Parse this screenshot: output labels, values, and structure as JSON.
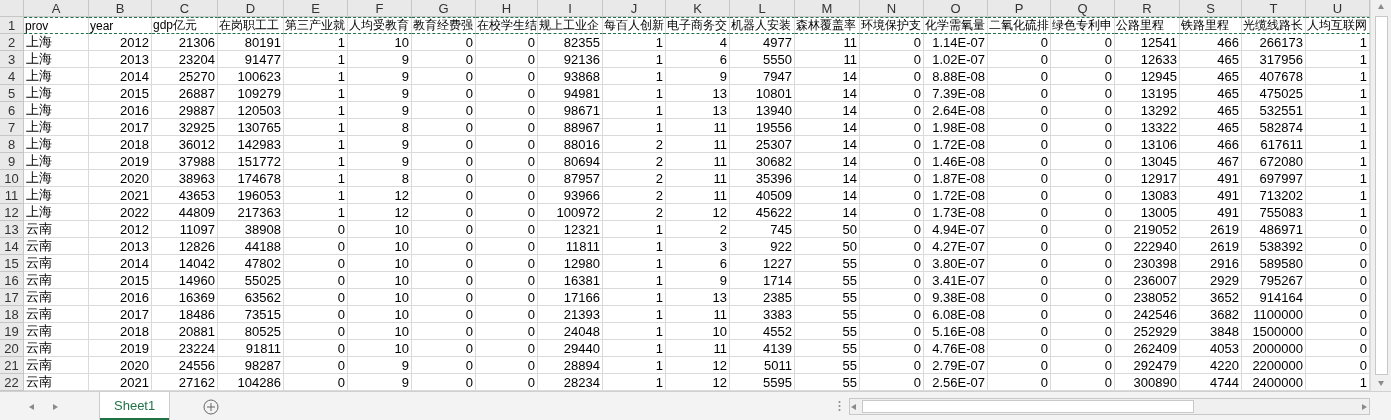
{
  "columns": [
    "A",
    "B",
    "C",
    "D",
    "E",
    "F",
    "G",
    "H",
    "I",
    "J",
    "K",
    "L",
    "M",
    "N",
    "O",
    "P",
    "Q",
    "R",
    "S",
    "T",
    "U"
  ],
  "rows": [
    {
      "number": "1",
      "header": true,
      "cells": [
        "prov",
        "year",
        "gdp亿元",
        "在岗职工工",
        "第三产业就",
        "人均受教育",
        "教育经费强",
        "在校学生结",
        "规上工业企",
        "每百人创新",
        "电子商务交",
        "机器人安装",
        "森林覆盖率",
        "环境保护支",
        "化学需氧量",
        "二氧化硫排",
        "绿色专利申",
        "公路里程",
        "铁路里程",
        "光缆线路长",
        "人均互联网"
      ]
    },
    {
      "number": "2",
      "header": false,
      "cells": [
        "上海",
        "2012",
        "21306",
        "80191",
        "1",
        "10",
        "0",
        "0",
        "82355",
        "1",
        "4",
        "4977",
        "11",
        "0",
        "1.14E-07",
        "0",
        "0",
        "12541",
        "466",
        "266173",
        "1"
      ]
    },
    {
      "number": "3",
      "header": false,
      "cells": [
        "上海",
        "2013",
        "23204",
        "91477",
        "1",
        "9",
        "0",
        "0",
        "92136",
        "1",
        "6",
        "5550",
        "11",
        "0",
        "1.02E-07",
        "0",
        "0",
        "12633",
        "465",
        "317956",
        "1"
      ]
    },
    {
      "number": "4",
      "header": false,
      "cells": [
        "上海",
        "2014",
        "25270",
        "100623",
        "1",
        "9",
        "0",
        "0",
        "93868",
        "1",
        "9",
        "7947",
        "14",
        "0",
        "8.88E-08",
        "0",
        "0",
        "12945",
        "465",
        "407678",
        "1"
      ]
    },
    {
      "number": "5",
      "header": false,
      "cells": [
        "上海",
        "2015",
        "26887",
        "109279",
        "1",
        "9",
        "0",
        "0",
        "94981",
        "1",
        "13",
        "10801",
        "14",
        "0",
        "7.39E-08",
        "0",
        "0",
        "13195",
        "465",
        "475025",
        "1"
      ]
    },
    {
      "number": "6",
      "header": false,
      "cells": [
        "上海",
        "2016",
        "29887",
        "120503",
        "1",
        "9",
        "0",
        "0",
        "98671",
        "1",
        "13",
        "13940",
        "14",
        "0",
        "2.64E-08",
        "0",
        "0",
        "13292",
        "465",
        "532551",
        "1"
      ]
    },
    {
      "number": "7",
      "header": false,
      "cells": [
        "上海",
        "2017",
        "32925",
        "130765",
        "1",
        "8",
        "0",
        "0",
        "88967",
        "1",
        "11",
        "19556",
        "14",
        "0",
        "1.98E-08",
        "0",
        "0",
        "13322",
        "465",
        "582874",
        "1"
      ]
    },
    {
      "number": "8",
      "header": false,
      "cells": [
        "上海",
        "2018",
        "36012",
        "142983",
        "1",
        "9",
        "0",
        "0",
        "88016",
        "2",
        "11",
        "25307",
        "14",
        "0",
        "1.72E-08",
        "0",
        "0",
        "13106",
        "466",
        "617611",
        "1"
      ]
    },
    {
      "number": "9",
      "header": false,
      "cells": [
        "上海",
        "2019",
        "37988",
        "151772",
        "1",
        "9",
        "0",
        "0",
        "80694",
        "2",
        "11",
        "30682",
        "14",
        "0",
        "1.46E-08",
        "0",
        "0",
        "13045",
        "467",
        "672080",
        "1"
      ]
    },
    {
      "number": "10",
      "header": false,
      "cells": [
        "上海",
        "2020",
        "38963",
        "174678",
        "1",
        "8",
        "0",
        "0",
        "87957",
        "2",
        "11",
        "35396",
        "14",
        "0",
        "1.87E-08",
        "0",
        "0",
        "12917",
        "491",
        "697997",
        "1"
      ]
    },
    {
      "number": "11",
      "header": false,
      "cells": [
        "上海",
        "2021",
        "43653",
        "196053",
        "1",
        "12",
        "0",
        "0",
        "93966",
        "2",
        "11",
        "40509",
        "14",
        "0",
        "1.72E-08",
        "0",
        "0",
        "13083",
        "491",
        "713202",
        "1"
      ]
    },
    {
      "number": "12",
      "header": false,
      "cells": [
        "上海",
        "2022",
        "44809",
        "217363",
        "1",
        "12",
        "0",
        "0",
        "100972",
        "2",
        "12",
        "45622",
        "14",
        "0",
        "1.73E-08",
        "0",
        "0",
        "13005",
        "491",
        "755083",
        "1"
      ]
    },
    {
      "number": "13",
      "header": false,
      "cells": [
        "云南",
        "2012",
        "11097",
        "38908",
        "0",
        "10",
        "0",
        "0",
        "12321",
        "1",
        "2",
        "745",
        "50",
        "0",
        "4.94E-07",
        "0",
        "0",
        "219052",
        "2619",
        "486971",
        "0"
      ]
    },
    {
      "number": "14",
      "header": false,
      "cells": [
        "云南",
        "2013",
        "12826",
        "44188",
        "0",
        "10",
        "0",
        "0",
        "11811",
        "1",
        "3",
        "922",
        "50",
        "0",
        "4.27E-07",
        "0",
        "0",
        "222940",
        "2619",
        "538392",
        "0"
      ]
    },
    {
      "number": "15",
      "header": false,
      "cells": [
        "云南",
        "2014",
        "14042",
        "47802",
        "0",
        "10",
        "0",
        "0",
        "12980",
        "1",
        "6",
        "1227",
        "55",
        "0",
        "3.80E-07",
        "0",
        "0",
        "230398",
        "2916",
        "589580",
        "0"
      ]
    },
    {
      "number": "16",
      "header": false,
      "cells": [
        "云南",
        "2015",
        "14960",
        "55025",
        "0",
        "10",
        "0",
        "0",
        "16381",
        "1",
        "9",
        "1714",
        "55",
        "0",
        "3.41E-07",
        "0",
        "0",
        "236007",
        "2929",
        "795267",
        "0"
      ]
    },
    {
      "number": "17",
      "header": false,
      "cells": [
        "云南",
        "2016",
        "16369",
        "63562",
        "0",
        "10",
        "0",
        "0",
        "17166",
        "1",
        "13",
        "2385",
        "55",
        "0",
        "9.38E-08",
        "0",
        "0",
        "238052",
        "3652",
        "914164",
        "0"
      ]
    },
    {
      "number": "18",
      "header": false,
      "cells": [
        "云南",
        "2017",
        "18486",
        "73515",
        "0",
        "10",
        "0",
        "0",
        "21393",
        "1",
        "11",
        "3383",
        "55",
        "0",
        "6.08E-08",
        "0",
        "0",
        "242546",
        "3682",
        "1100000",
        "0"
      ]
    },
    {
      "number": "19",
      "header": false,
      "cells": [
        "云南",
        "2018",
        "20881",
        "80525",
        "0",
        "10",
        "0",
        "0",
        "24048",
        "1",
        "10",
        "4552",
        "55",
        "0",
        "5.16E-08",
        "0",
        "0",
        "252929",
        "3848",
        "1500000",
        "0"
      ]
    },
    {
      "number": "20",
      "header": false,
      "cells": [
        "云南",
        "2019",
        "23224",
        "91811",
        "0",
        "10",
        "0",
        "0",
        "29440",
        "1",
        "11",
        "4139",
        "55",
        "0",
        "4.76E-08",
        "0",
        "0",
        "262409",
        "4053",
        "2000000",
        "0"
      ]
    },
    {
      "number": "21",
      "header": false,
      "cells": [
        "云南",
        "2020",
        "24556",
        "98287",
        "0",
        "9",
        "0",
        "0",
        "28894",
        "1",
        "12",
        "5011",
        "55",
        "0",
        "2.79E-07",
        "0",
        "0",
        "292479",
        "4220",
        "2200000",
        "0"
      ]
    },
    {
      "number": "22",
      "header": false,
      "cells": [
        "云南",
        "2021",
        "27162",
        "104286",
        "0",
        "9",
        "0",
        "0",
        "28234",
        "1",
        "12",
        "5595",
        "55",
        "0",
        "2.56E-07",
        "0",
        "0",
        "300890",
        "4744",
        "2400000",
        "1"
      ]
    }
  ],
  "sheet_tabs": [
    {
      "label": "Sheet1",
      "selected": true
    }
  ]
}
